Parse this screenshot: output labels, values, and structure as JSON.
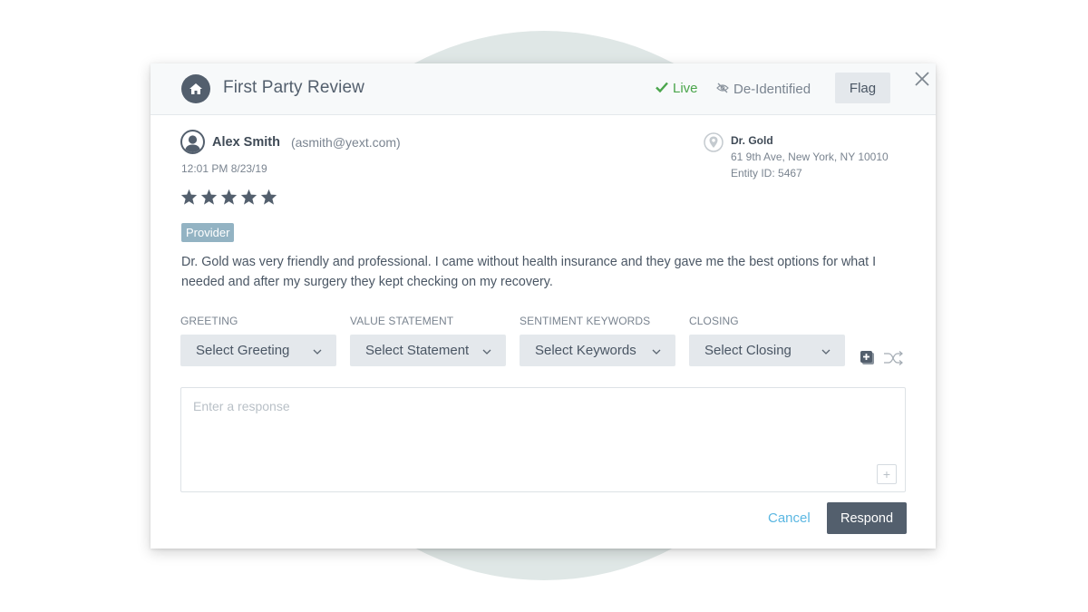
{
  "header": {
    "icon": "home-icon",
    "title": "First Party Review",
    "status_live": "Live",
    "status_live_icon": "checkmark-icon",
    "status_live_color": "#4aa54b",
    "deidentified": "De-Identified",
    "deidentified_icon": "eye-slash-icon",
    "flag_label": "Flag",
    "close_icon": "close-icon"
  },
  "review": {
    "author_name": "Alex Smith",
    "author_email": "(asmith@yext.com)",
    "timestamp": "12:01 PM 8/23/19",
    "rating": 5,
    "rating_max": 5,
    "tag": "Provider",
    "text": "Dr. Gold was very friendly and professional. I came without health insurance and they gave me the best options for what I needed and after my surgery they kept checking on my recovery."
  },
  "entity": {
    "name": "Dr. Gold",
    "address": "61 9th Ave, New York, NY 10010",
    "entity_id": "Entity ID: 5467"
  },
  "response_builder": {
    "dropdowns": [
      {
        "label": "GREETING",
        "value": "Select Greeting"
      },
      {
        "label": "VALUE STATEMENT",
        "value": "Select Statement"
      },
      {
        "label": "SENTIMENT KEYWORDS",
        "value": "Select Keywords"
      },
      {
        "label": "CLOSING",
        "value": "Select Closing"
      }
    ],
    "add_icon": "add-template-icon",
    "shuffle_icon": "shuffle-icon"
  },
  "response": {
    "value": "",
    "placeholder": "Enter a response",
    "add_label": "+"
  },
  "actions": {
    "cancel_label": "Cancel",
    "respond_label": "Respond"
  },
  "colors": {
    "accent_dark": "#535f6d",
    "link": "#5bb7e2",
    "tag_bg": "#93b3c3",
    "background_circle": "#dfe7e6"
  }
}
